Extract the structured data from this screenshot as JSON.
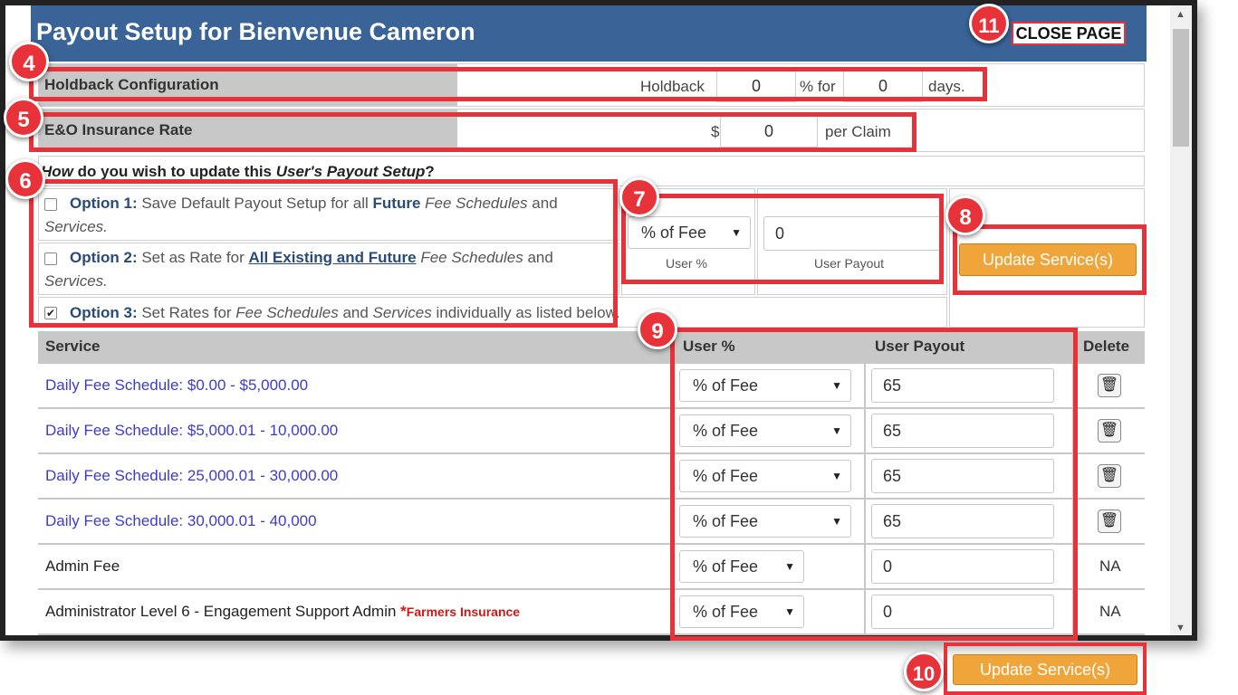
{
  "title": "Payout Setup for Bienvenue Cameron",
  "close_button": "CLOSE PAGE",
  "holdback": {
    "label": "Holdback Configuration",
    "prefix": "Holdback",
    "percent_value": "0",
    "middle": "% for",
    "days_value": "0",
    "suffix": "days."
  },
  "eo": {
    "label": "E&O Insurance Rate",
    "currency": "$",
    "value": "0",
    "suffix": "per Claim"
  },
  "question": {
    "how": "How",
    "mid": "do you wish to update this",
    "user": "User's Payout Setup",
    "end": "?"
  },
  "options": [
    {
      "title": "Option 1:",
      "line1_a": "Save Default Payout Setup for all",
      "line1_bold": "Future",
      "line1_italic": "Fee Schedules",
      "line1_b": "and",
      "line2": "Services.",
      "checked": false
    },
    {
      "title": "Option 2:",
      "line1_a": "Set as Rate for",
      "line1_bold": "All Existing and Future",
      "line1_italic": "Fee Schedules",
      "line1_b": "and",
      "line2": "Services.",
      "checked": false
    },
    {
      "title": "Option 3:",
      "text_a": "Set Rates for",
      "italic1": "Fee Schedules",
      "text_b": "and",
      "italic2": "Services",
      "text_c": "individually as listed below.",
      "checked": true
    }
  ],
  "bulk": {
    "select_value": "% of Fee",
    "select_label": "User %",
    "payout_value": "0",
    "payout_label": "User Payout",
    "update_button": "Update Service(s)"
  },
  "table": {
    "headers": [
      "Service",
      "User %",
      "User Payout",
      "Delete"
    ],
    "rows": [
      {
        "service": "Daily Fee Schedule: $0.00 - $5,000.00",
        "type": "link",
        "user_pct": "% of Fee",
        "payout": "65",
        "delete": "trash"
      },
      {
        "service": "Daily Fee Schedule: $5,000.01 - 10,000.00",
        "type": "link",
        "user_pct": "% of Fee",
        "payout": "65",
        "delete": "trash"
      },
      {
        "service": "Daily Fee Schedule: 25,000.01 - 30,000.00",
        "type": "link",
        "user_pct": "% of Fee",
        "payout": "65",
        "delete": "trash"
      },
      {
        "service": "Daily Fee Schedule: 30,000.01 - 40,000",
        "type": "link",
        "user_pct": "% of Fee",
        "payout": "65",
        "delete": "trash"
      },
      {
        "service": "Admin Fee",
        "type": "plain",
        "user_pct": "% of Fee",
        "payout": "0",
        "delete": "NA"
      },
      {
        "service": "Administrator Level 6 - Engagement Support Admin",
        "type": "plain",
        "marker": "*",
        "tag": "Farmers Insurance",
        "user_pct": "% of Fee",
        "payout": "0",
        "delete": "NA"
      }
    ]
  },
  "bottom_update_button": "Update Service(s)",
  "badges": [
    "4",
    "5",
    "6",
    "7",
    "8",
    "9",
    "10",
    "11"
  ],
  "icons": {
    "trash": "trash-icon",
    "dropdown": "chevron-down-icon"
  },
  "colors": {
    "header": "#3a6498",
    "accent": "#e8323a",
    "button": "#f0a53a",
    "link": "#3d3ad0"
  }
}
